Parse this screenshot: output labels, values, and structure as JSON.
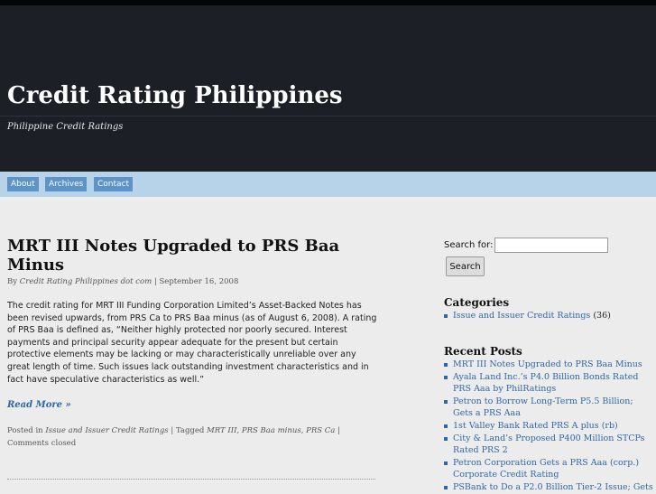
{
  "site": {
    "title": "Credit Rating Philippines",
    "description": "Philippine Credit Ratings"
  },
  "nav": {
    "items": [
      {
        "label": "About"
      },
      {
        "label": "Archives"
      },
      {
        "label": "Contact"
      }
    ]
  },
  "post": {
    "title": "MRT III Notes Upgraded to PRS Baa Minus",
    "by_label": "By",
    "author": "Credit Rating Philippines dot com",
    "date": "September 16, 2008",
    "body": "The credit rating for MRT III Funding Corporation Limited’s Asset-Backed Notes has been revised upwards, from PRS Ca to PRS Baa minus (as of August 6, 2008). A rating of PRS Baa is defined as, “Neither highly protected nor poorly secured. Interest payments and principal security appear adequate for the present but certain protective elements may be lacking or may characteristically unreliable over any great length of time. Such issues lack outstanding investment characteristics and in fact have speculative characteristics as well.”",
    "read_more": "Read More »",
    "posted_in_label": "Posted in",
    "category": "Issue and Issuer Credit Ratings",
    "tagged_label": "Tagged",
    "tags": [
      "MRT III",
      "PRS Baa minus",
      "PRS Ca"
    ],
    "comments": "Comments closed"
  },
  "sidebar": {
    "search": {
      "label": "Search for:",
      "value": "",
      "button": "Search"
    },
    "categories": {
      "title": "Categories",
      "items": [
        {
          "label": "Issue and Issuer Credit Ratings",
          "count": "(36)"
        }
      ]
    },
    "recent_posts": {
      "title": "Recent Posts",
      "items": [
        {
          "label": "MRT III Notes Upgraded to PRS Baa Minus"
        },
        {
          "label": "Ayala Land Inc.’s P4.0 Billion Bonds Rated PRS Aaa by PhilRatings"
        },
        {
          "label": "Petron to Borrow Long-Term P5.5 Billion; Gets a PRS Aaa"
        },
        {
          "label": "1st Valley Bank Rated PRS A plus (rb)"
        },
        {
          "label": "City & Land’s Proposed P400 Million STCPs Rated PRS 2"
        },
        {
          "label": "Petron Corporation Gets a PRS Aaa (corp.) Corporate Credit Rating"
        },
        {
          "label": "PSBank to Do a P2.0 Billion Tier-2 Issue; Gets"
        }
      ]
    }
  },
  "colors": {
    "header_bg": "#1c1f26",
    "nav_bg": "#b7d3ea",
    "nav_item_bg": "#5d93c6",
    "link": "#2e67a8",
    "page_bg": "#ececec"
  }
}
